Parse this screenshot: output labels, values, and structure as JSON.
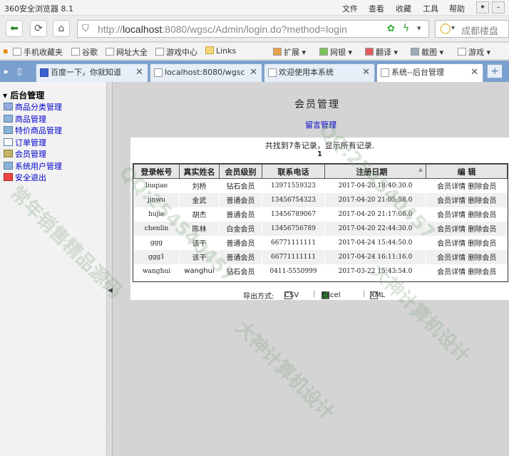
{
  "browser": {
    "title": "360安全浏览器 8.1",
    "menu": [
      "文件",
      "查看",
      "收藏",
      "工具",
      "帮助"
    ],
    "url_prefix": "http://",
    "url_host": "localhost",
    "url_rest": ":8080/wgsc/Admin/login.do?method=login",
    "search_placeholder": "成都楼盘"
  },
  "bookmarks": [
    "手机收藏夹",
    "谷歌",
    "网址大全",
    "游戏中心",
    "Links",
    "扩展",
    "网银",
    "翻译",
    "截图",
    "游戏"
  ],
  "tabs": [
    {
      "label": "百度一下，你就知道"
    },
    {
      "label": "localhost:8080/wgsc"
    },
    {
      "label": "欢迎使用本系统"
    },
    {
      "label": "系统--后台管理"
    }
  ],
  "sidebar": {
    "title": "后台管理",
    "items": [
      {
        "label": "商品分类管理"
      },
      {
        "label": "商品管理"
      },
      {
        "label": "特价商品管理"
      },
      {
        "label": "订单管理"
      },
      {
        "label": "会员管理"
      },
      {
        "label": "系统用户管理"
      },
      {
        "label": "安全退出"
      }
    ]
  },
  "main": {
    "title": "会员管理",
    "message_link": "留言管理",
    "record_info": "共找到7条记录，显示所有记录.",
    "page_number": "1",
    "columns": [
      "登录帐号",
      "真实姓名",
      "会员级别",
      "联系电话",
      "注册日期",
      "编 辑"
    ],
    "rows": [
      {
        "account": "liuqiao",
        "name": "刘桥",
        "level": "钻石会员",
        "phone": "13971559323",
        "date": "2017-04-20 18:40:30.0"
      },
      {
        "account": "jinwu",
        "name": "金武",
        "level": "普通会员",
        "phone": "13456754323",
        "date": "2017-04-20 21:05:58.0"
      },
      {
        "account": "hujie",
        "name": "胡杰",
        "level": "普通会员",
        "phone": "13456789067",
        "date": "2017-04-20 21:17:08.0"
      },
      {
        "account": "chenlin",
        "name": "陈林",
        "level": "白金会员",
        "phone": "13456756789",
        "date": "2017-04-20 22:44:30.0"
      },
      {
        "account": "ggg",
        "name": "该干",
        "level": "普通会员",
        "phone": "66771111111",
        "date": "2017-04-24 15:44:50.0"
      },
      {
        "account": "ggg1",
        "name": "该干",
        "level": "普通会员",
        "phone": "66771111111",
        "date": "2017-04-24 16:11:16.0"
      },
      {
        "account": "wanghui",
        "name": "wanghui",
        "level": "钻石会员",
        "phone": "0411-5550999",
        "date": "2017-03-22 15:43:54.0"
      }
    ],
    "detail_label": "会员详情",
    "delete_label": "删除会员",
    "export_label": "导出方式:",
    "export_csv": "CSV",
    "export_excel": "Excel",
    "export_xml": "XML"
  },
  "watermarks": [
    "常年销售精品源码",
    "QQ:254540457",
    "大神计算机设计"
  ]
}
